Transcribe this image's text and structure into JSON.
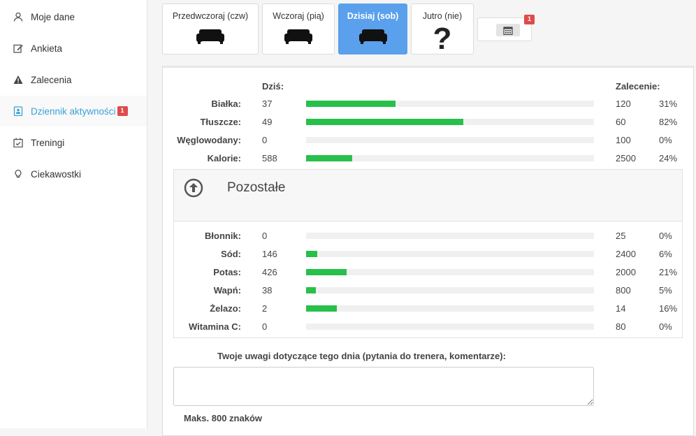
{
  "sidebar": {
    "items": [
      {
        "label": "Moje dane",
        "icon": "user-icon"
      },
      {
        "label": "Ankieta",
        "icon": "edit-icon"
      },
      {
        "label": "Zalecenia",
        "icon": "warning-icon"
      },
      {
        "label": "Dziennik aktywności",
        "icon": "contact-card-icon",
        "badge": "1",
        "active": true
      },
      {
        "label": "Treningi",
        "icon": "calendar-check-icon"
      },
      {
        "label": "Ciekawostki",
        "icon": "lightbulb-icon"
      }
    ]
  },
  "days": [
    {
      "label": "Przedwczoraj (czw)",
      "icon": "sofa-icon"
    },
    {
      "label": "Wczoraj (pią)",
      "icon": "sofa-icon"
    },
    {
      "label": "Dzisiaj (sob)",
      "icon": "sofa-icon",
      "active": true
    },
    {
      "label": "Jutro (nie)",
      "icon": "question-icon"
    }
  ],
  "calendar": {
    "badge": "1"
  },
  "headers": {
    "today": "Dziś:",
    "recommend": "Zalecenie:"
  },
  "macros": [
    {
      "label": "Białka:",
      "value": "37",
      "rec": "120",
      "pct": "31%",
      "fill": 0.31
    },
    {
      "label": "Tłuszcze:",
      "value": "49",
      "rec": "60",
      "pct": "82%",
      "fill": 0.545
    },
    {
      "label": "Węglowodany:",
      "value": "0",
      "rec": "100",
      "pct": "0%",
      "fill": 0
    },
    {
      "label": "Kalorie:",
      "value": "588",
      "rec": "2500",
      "pct": "24%",
      "fill": 0.16
    }
  ],
  "remaining": {
    "title": "Pozostałe"
  },
  "micros": [
    {
      "label": "Błonnik:",
      "value": "0",
      "rec": "25",
      "pct": "0%",
      "fill": 0
    },
    {
      "label": "Sód:",
      "value": "146",
      "rec": "2400",
      "pct": "6%",
      "fill": 0.04
    },
    {
      "label": "Potas:",
      "value": "426",
      "rec": "2000",
      "pct": "21%",
      "fill": 0.14
    },
    {
      "label": "Wapń:",
      "value": "38",
      "rec": "800",
      "pct": "5%",
      "fill": 0.035
    },
    {
      "label": "Żelazo:",
      "value": "2",
      "rec": "14",
      "pct": "16%",
      "fill": 0.107
    },
    {
      "label": "Witamina C:",
      "value": "0",
      "rec": "80",
      "pct": "0%",
      "fill": 0
    }
  ],
  "notes": {
    "label": "Twoje uwagi dotyczące tego dnia (pytania do trenera, komentarze):",
    "value": "",
    "max": "Maks. 800 znaków"
  },
  "colors": {
    "accent": "#5aa0ec",
    "bar": "#27c04a",
    "badge": "#e04b4b",
    "activeText": "#3aa1d9"
  }
}
